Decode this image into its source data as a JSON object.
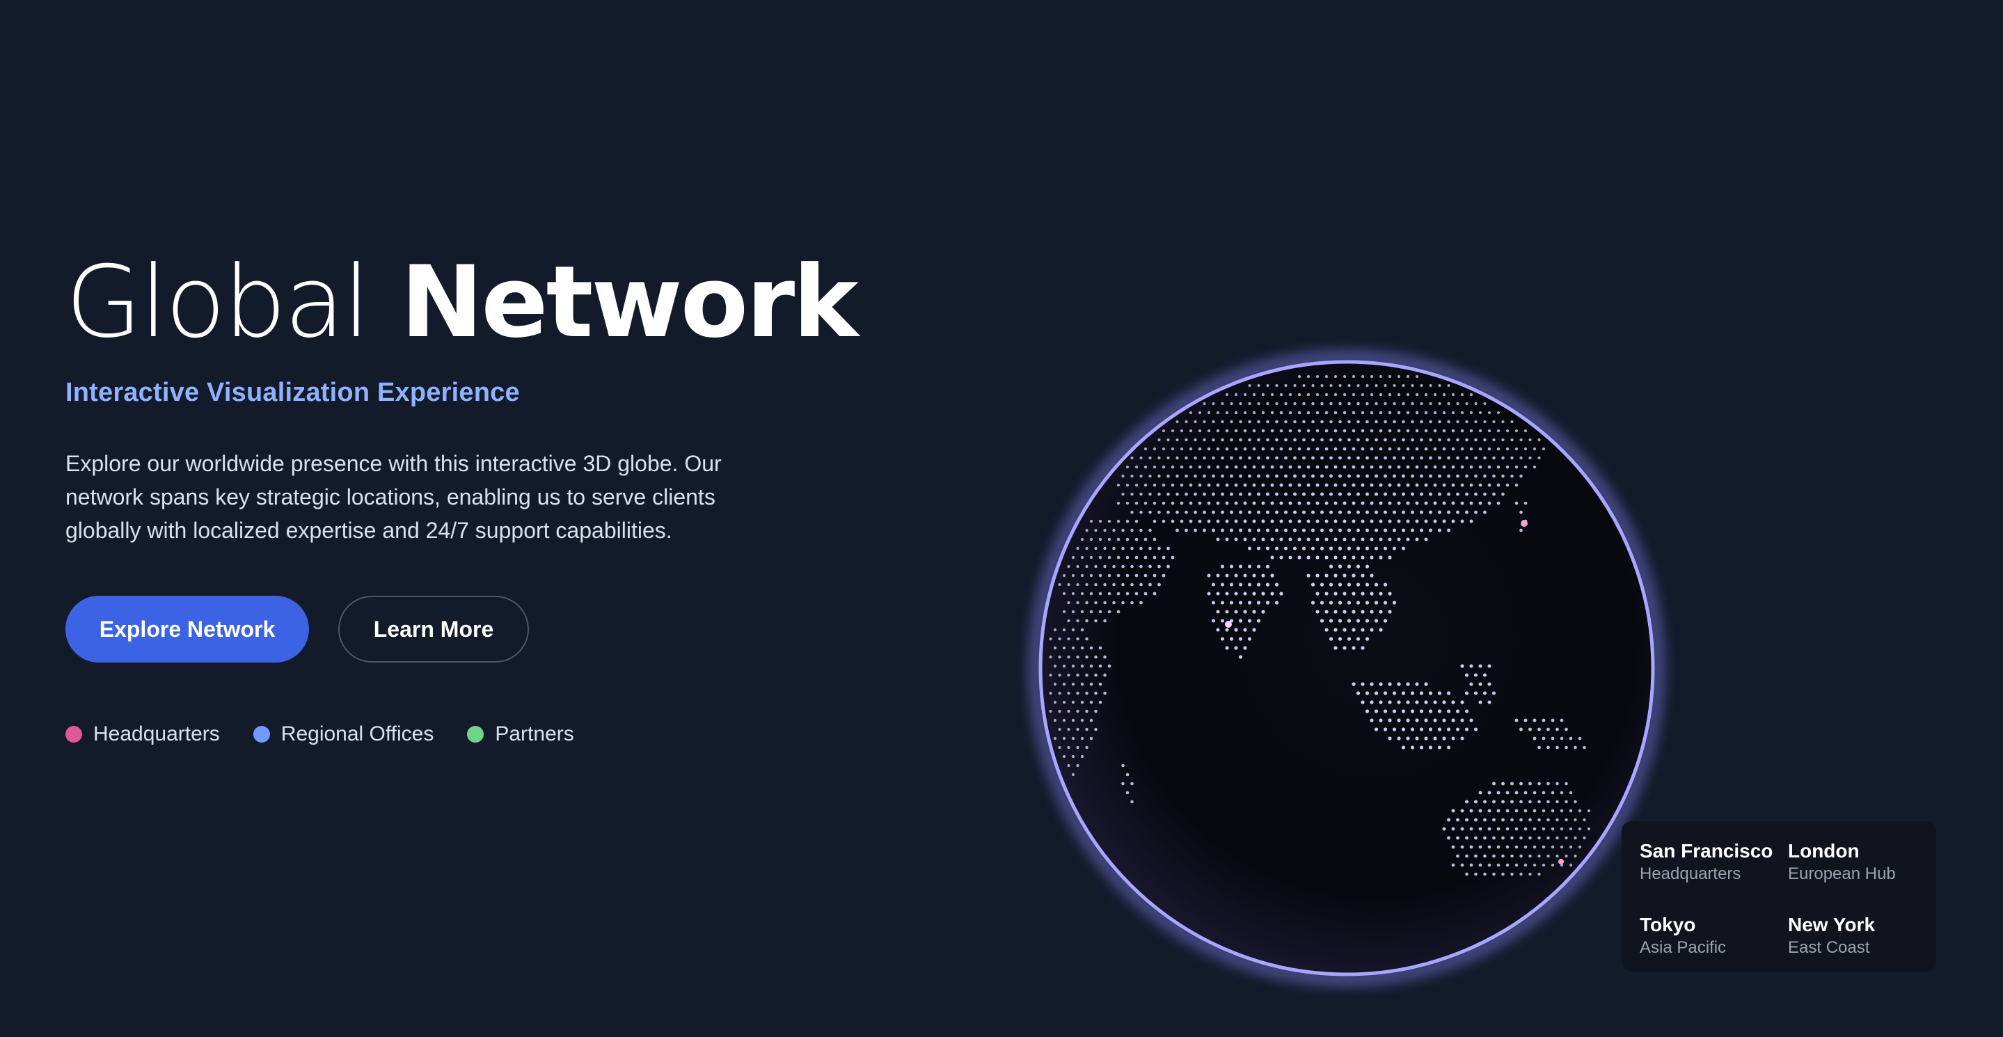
{
  "hero": {
    "title_light": "Global",
    "title_bold": "Network",
    "subtitle": "Interactive Visualization Experience",
    "description": "Explore our worldwide presence with this interactive 3D globe. Our network spans key strategic locations, enabling us to serve clients globally with localized expertise and 24/7 support capabilities.",
    "primary_button": "Explore Network",
    "secondary_button": "Learn More"
  },
  "legend": [
    {
      "label": "Headquarters",
      "color": "#e0579a"
    },
    {
      "label": "Regional Offices",
      "color": "#6f9bff"
    },
    {
      "label": "Partners",
      "color": "#6fd48a"
    }
  ],
  "cities": [
    {
      "name": "San Francisco",
      "role": "Headquarters"
    },
    {
      "name": "London",
      "role": "European Hub"
    },
    {
      "name": "Tokyo",
      "role": "Asia Pacific"
    },
    {
      "name": "New York",
      "role": "East Coast"
    }
  ],
  "colors": {
    "background": "#131a29",
    "accent": "#3b63e3",
    "subtitle": "#8fb2ff",
    "globe_rim": "#a7a6ff",
    "land_dots": "#ded8ff"
  }
}
